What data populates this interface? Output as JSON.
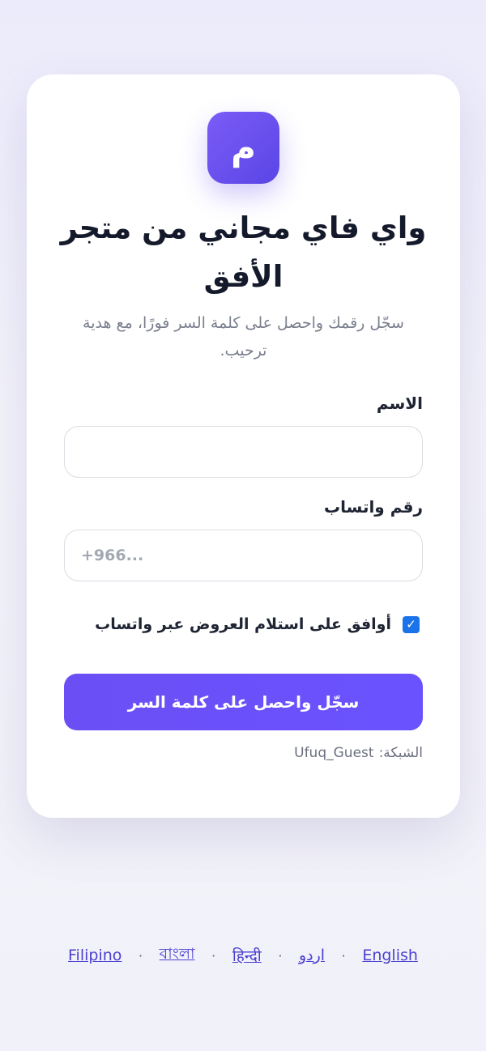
{
  "brand": {
    "logo_letter": "م",
    "accent_color": "#6b4ff5"
  },
  "header": {
    "title": "واي فاي مجاني من متجر الأفق",
    "subtitle": "سجّل رقمك واحصل على كلمة السر فورًا، مع هدية ترحيب."
  },
  "form": {
    "name_label": "الاسم",
    "name_value": "",
    "phone_label": "رقم واتساب",
    "phone_placeholder": "+966...",
    "phone_value": "",
    "consent_checked": true,
    "consent_label": "أوافق على استلام العروض عبر واتساب",
    "submit_label": "سجّل واحصل على كلمة السر"
  },
  "network": {
    "label": "الشبكة:",
    "ssid": "Ufuq_Guest"
  },
  "languages": [
    "Filipino",
    "বাংলা",
    "हिन्दी",
    "اردو",
    "English"
  ],
  "language_separator": "·"
}
